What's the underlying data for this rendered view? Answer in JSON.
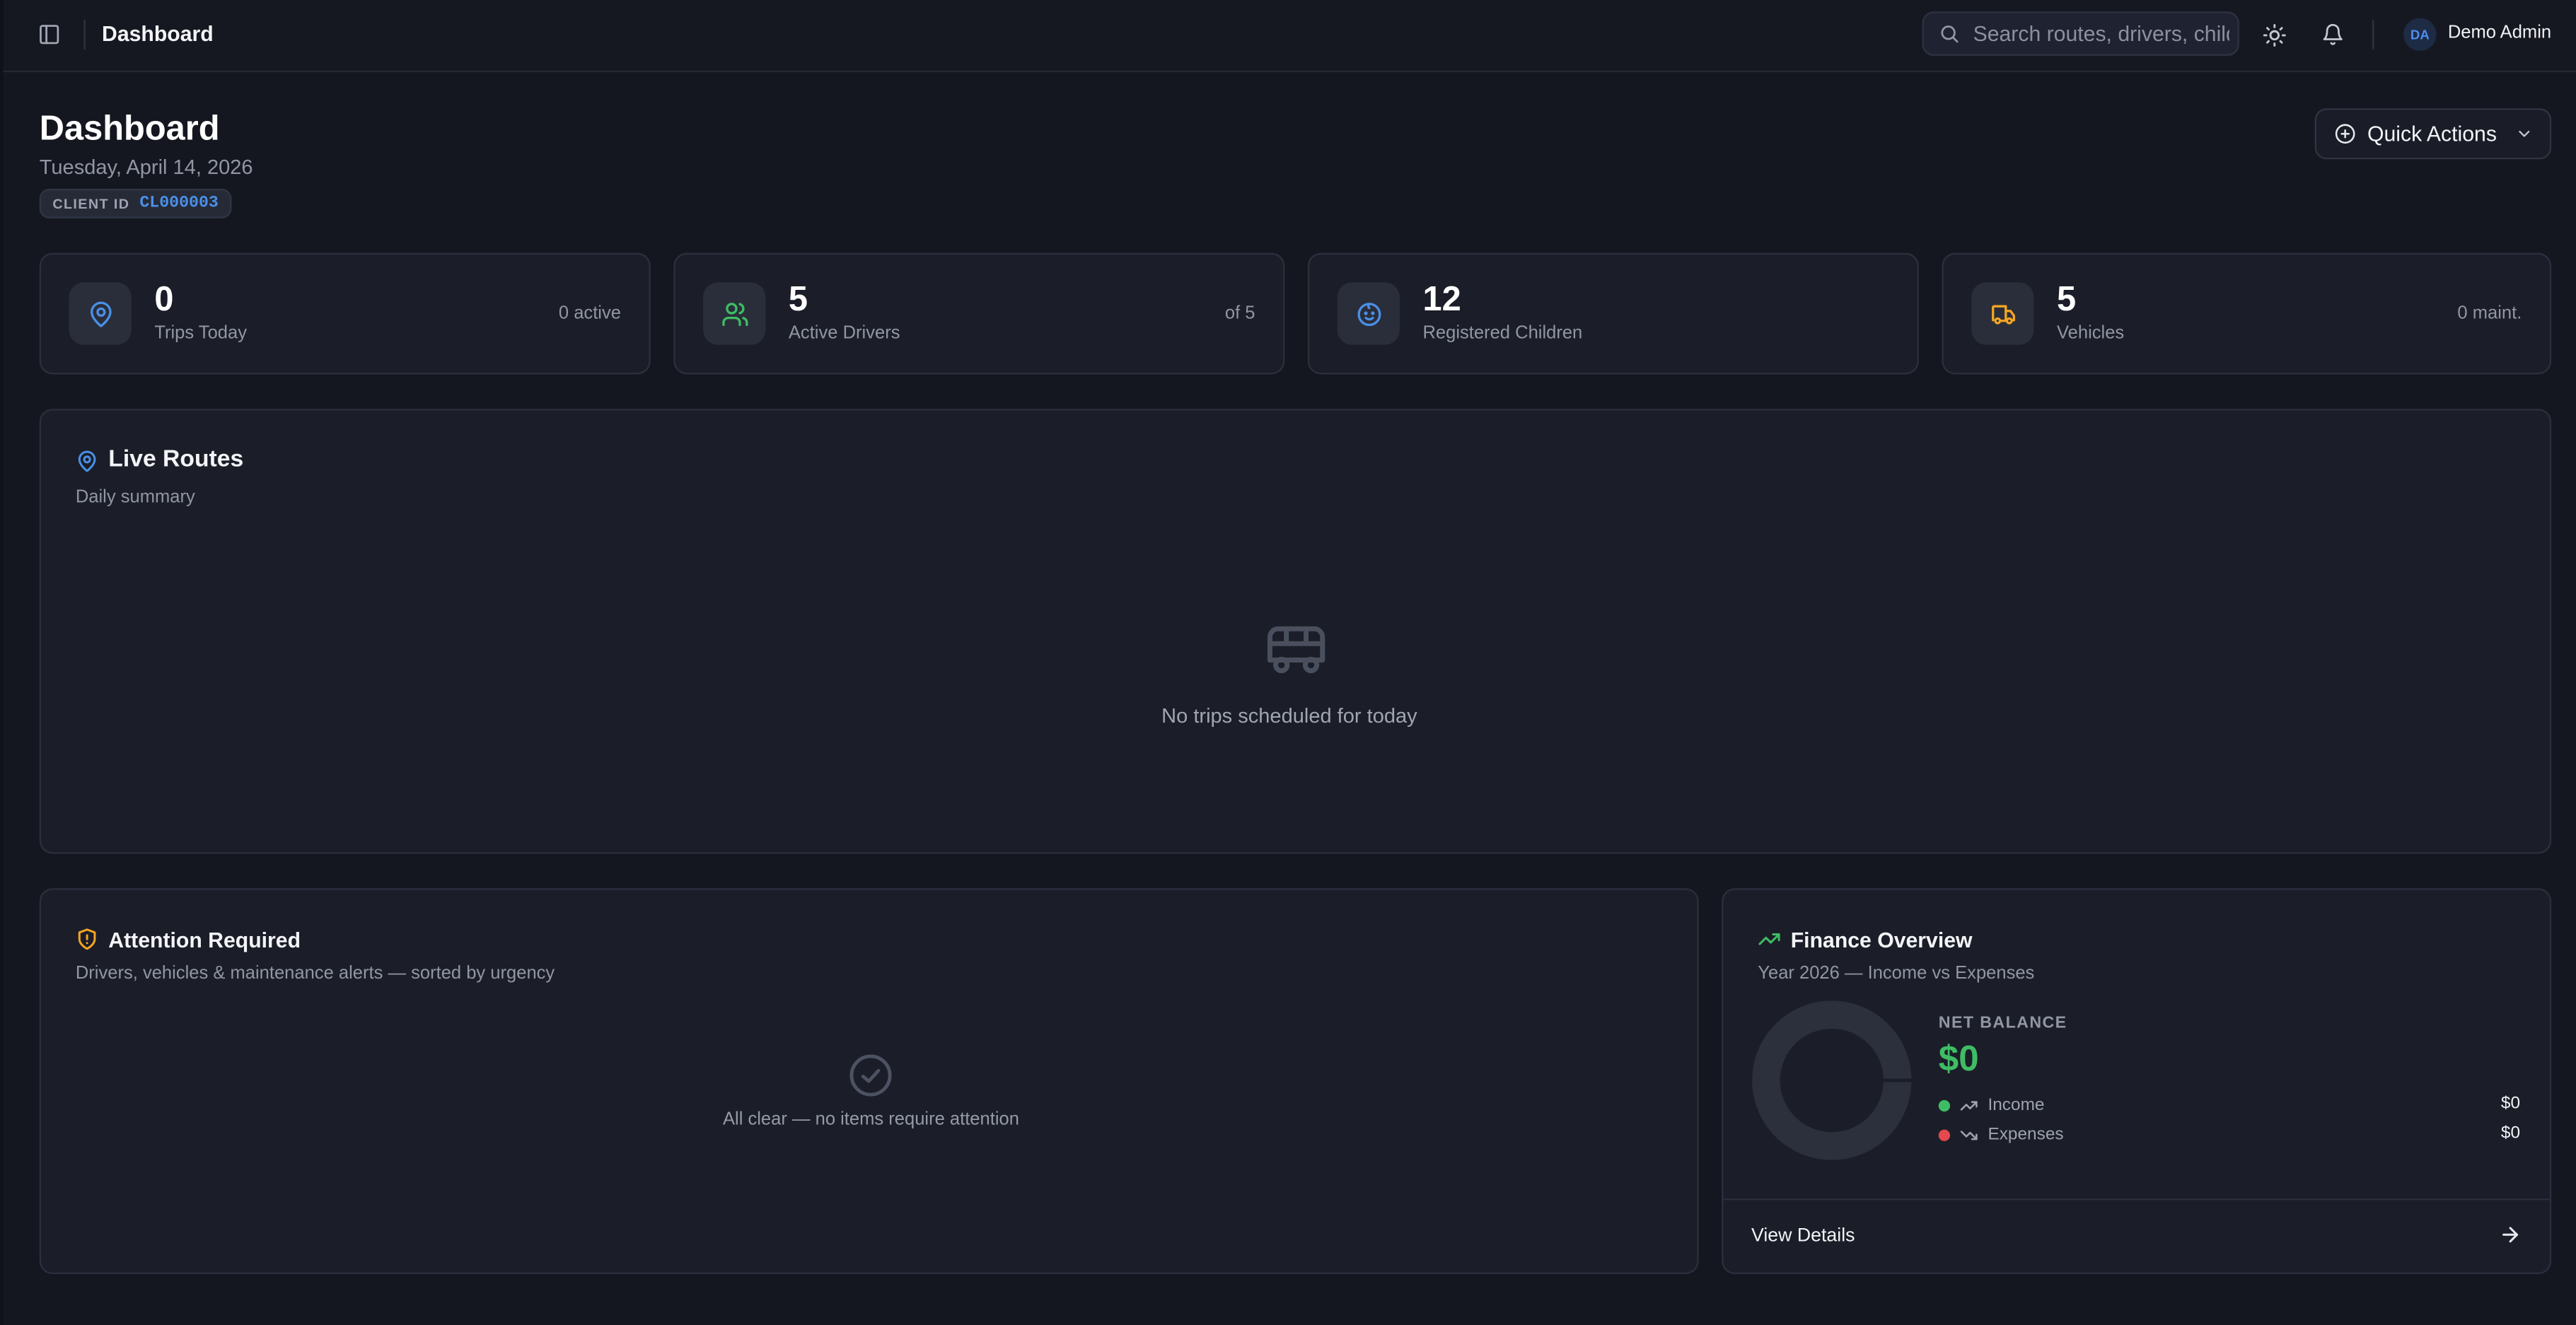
{
  "header": {
    "breadcrumb": "Dashboard",
    "search_placeholder": "Search routes, drivers, children...",
    "user_initials": "DA",
    "user_name": "Demo Admin"
  },
  "page": {
    "title": "Dashboard",
    "date": "Tuesday, April 14, 2026",
    "client_id_label": "CLIENT ID",
    "client_id_value": "CL000003",
    "quick_actions_label": "Quick Actions"
  },
  "stats": [
    {
      "value": "0",
      "label": "Trips Today",
      "meta": "0 active",
      "icon": "map-pin-icon",
      "color": "#4a90e8"
    },
    {
      "value": "5",
      "label": "Active Drivers",
      "meta": "of 5",
      "icon": "users-icon",
      "color": "#3fbd64"
    },
    {
      "value": "12",
      "label": "Registered Children",
      "meta": "",
      "icon": "baby-face-icon",
      "color": "#4a90e8"
    },
    {
      "value": "5",
      "label": "Vehicles",
      "meta": "0 maint.",
      "icon": "truck-icon",
      "color": "#f5a623"
    }
  ],
  "live_routes": {
    "title": "Live Routes",
    "subtitle": "Daily summary",
    "empty_text": "No trips scheduled for today"
  },
  "attention": {
    "title": "Attention Required",
    "subtitle": "Drivers, vehicles & maintenance alerts — sorted by urgency",
    "empty_text": "All clear — no items require attention"
  },
  "finance": {
    "title": "Finance Overview",
    "subtitle": "Year 2026 — Income vs Expenses",
    "net_label": "NET BALANCE",
    "net_value": "$0",
    "income_label": "Income",
    "income_value": "$0",
    "expenses_label": "Expenses",
    "expenses_value": "$0",
    "view_details": "View Details"
  },
  "colors": {
    "accent_blue": "#4a90e8",
    "accent_green": "#3fbd64",
    "accent_orange": "#f5a623",
    "accent_red": "#e5484d"
  }
}
